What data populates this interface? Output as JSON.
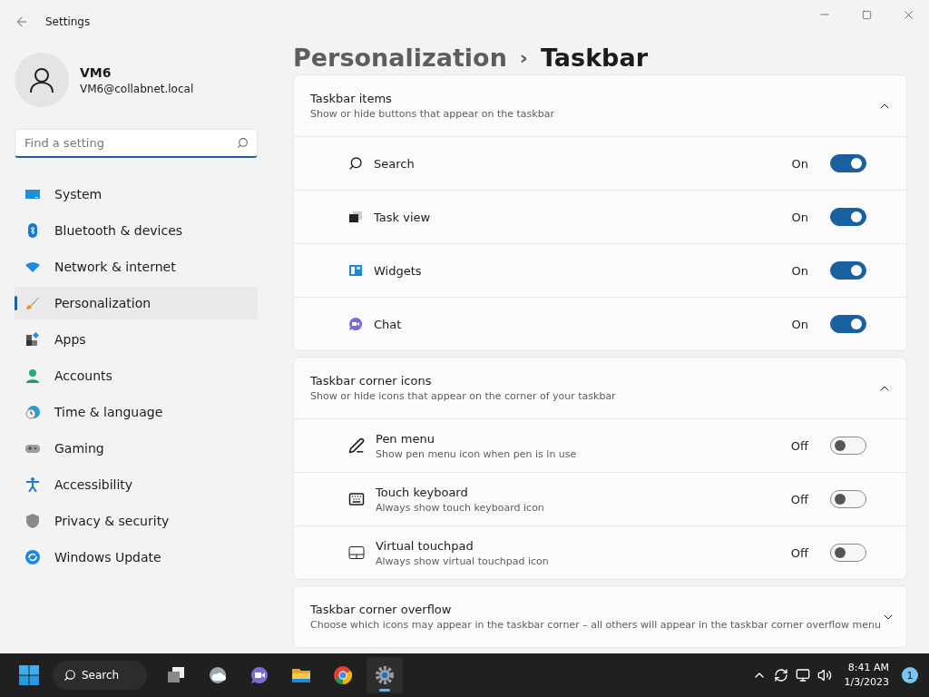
{
  "window": {
    "title": "Settings"
  },
  "user": {
    "name": "VM6",
    "email": "VM6@collabnet.local"
  },
  "search": {
    "placeholder": "Find a setting"
  },
  "nav": [
    {
      "label": "System",
      "kind": "system",
      "selected": false
    },
    {
      "label": "Bluetooth & devices",
      "kind": "bluetooth",
      "selected": false
    },
    {
      "label": "Network & internet",
      "kind": "network",
      "selected": false
    },
    {
      "label": "Personalization",
      "kind": "brush",
      "selected": true
    },
    {
      "label": "Apps",
      "kind": "apps",
      "selected": false
    },
    {
      "label": "Accounts",
      "kind": "accounts",
      "selected": false
    },
    {
      "label": "Time & language",
      "kind": "time",
      "selected": false
    },
    {
      "label": "Gaming",
      "kind": "gaming",
      "selected": false
    },
    {
      "label": "Accessibility",
      "kind": "accessibility",
      "selected": false
    },
    {
      "label": "Privacy & security",
      "kind": "privacy",
      "selected": false
    },
    {
      "label": "Windows Update",
      "kind": "update",
      "selected": false
    }
  ],
  "breadcrumb": {
    "parent": "Personalization",
    "separator": "›",
    "current": "Taskbar"
  },
  "sections": [
    {
      "title": "Taskbar items",
      "description": "Show or hide buttons that appear on the taskbar",
      "expanded": true,
      "rows": [
        {
          "label": "Search",
          "kind": "search",
          "state": "On",
          "on": true
        },
        {
          "label": "Task view",
          "kind": "taskview",
          "state": "On",
          "on": true
        },
        {
          "label": "Widgets",
          "kind": "widgets",
          "state": "On",
          "on": true
        },
        {
          "label": "Chat",
          "kind": "chat",
          "state": "On",
          "on": true
        }
      ]
    },
    {
      "title": "Taskbar corner icons",
      "description": "Show or hide icons that appear on the corner of your taskbar",
      "expanded": true,
      "rows": [
        {
          "label": "Pen menu",
          "description": "Show pen menu icon when pen is in use",
          "kind": "pen",
          "state": "Off",
          "on": false
        },
        {
          "label": "Touch keyboard",
          "description": "Always show touch keyboard icon",
          "kind": "keyboard",
          "state": "Off",
          "on": false
        },
        {
          "label": "Virtual touchpad",
          "description": "Always show virtual touchpad icon",
          "kind": "touchpad",
          "state": "Off",
          "on": false
        }
      ]
    },
    {
      "title": "Taskbar corner overflow",
      "description": "Choose which icons may appear in the taskbar corner – all others will appear in the taskbar corner overflow menu",
      "expanded": false
    }
  ],
  "taskbar": {
    "search_label": "Search",
    "apps": [
      {
        "kind": "taskview",
        "selected": false
      },
      {
        "kind": "widgets",
        "selected": false
      },
      {
        "kind": "chat",
        "selected": false
      },
      {
        "kind": "explorer",
        "selected": false
      },
      {
        "kind": "chrome",
        "selected": false
      },
      {
        "kind": "settings",
        "selected": true
      }
    ],
    "time": "8:41 AM",
    "date": "1/3/2023",
    "notifications": "1"
  }
}
